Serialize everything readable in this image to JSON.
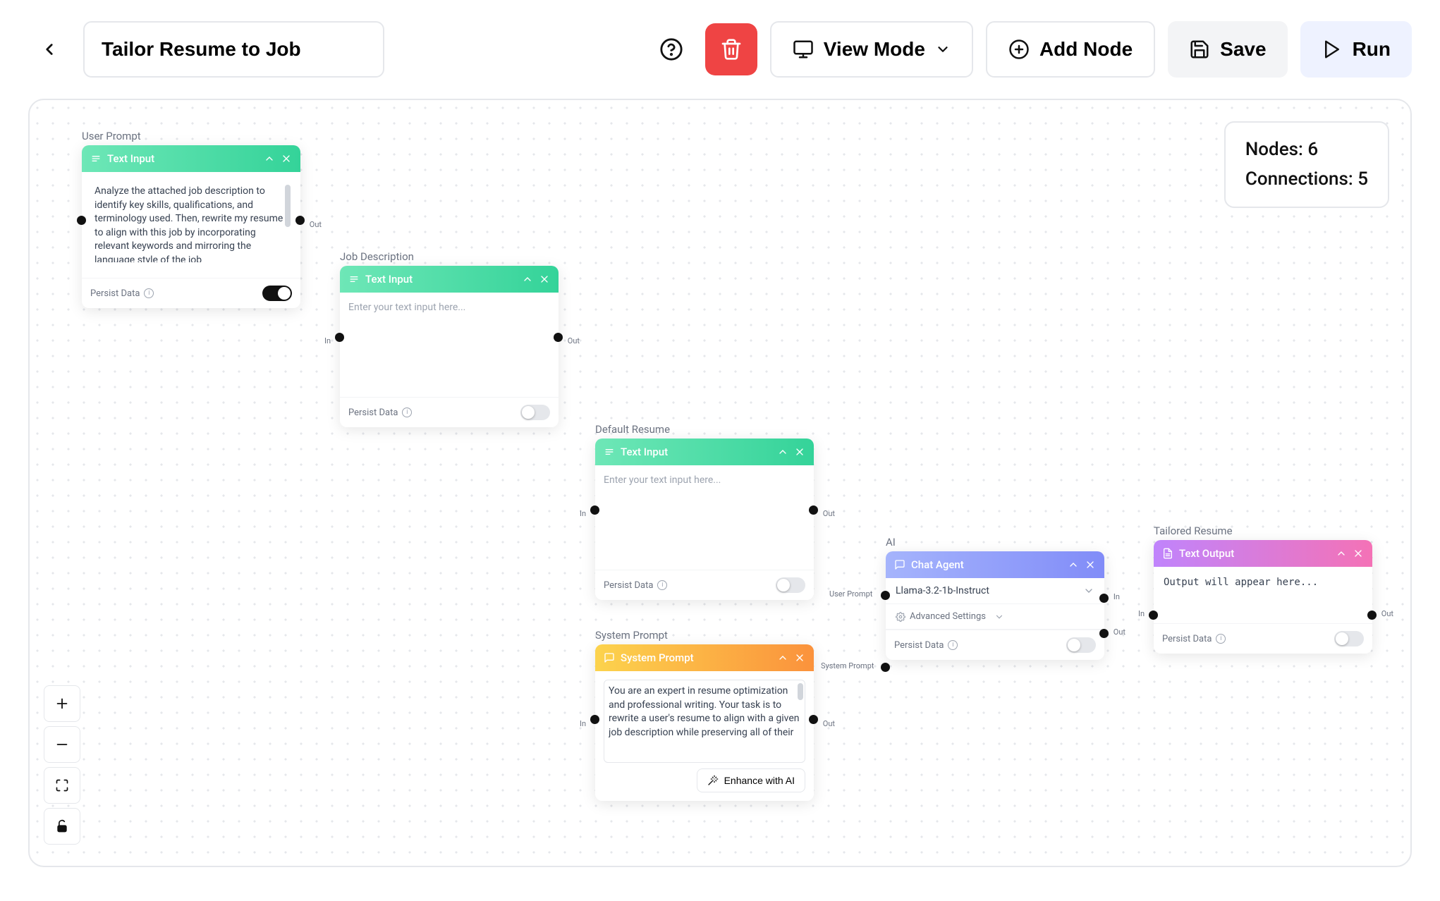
{
  "header": {
    "title": "Tailor Resume to Job",
    "view_mode": "View Mode",
    "add_node": "Add Node",
    "save": "Save",
    "run": "Run"
  },
  "stats": {
    "nodes_label": "Nodes: 6",
    "connections_label": "Connections: 5"
  },
  "nodes": {
    "user_prompt": {
      "label": "User Prompt",
      "type": "Text Input",
      "text": "Analyze the attached job description to identify key skills, qualifications, and terminology used. Then, rewrite my resume to align with this job by incorporating relevant keywords and mirroring the language style of the job",
      "persist_label": "Persist Data",
      "persist_on": true,
      "out_label": "Out"
    },
    "job_description": {
      "label": "Job Description",
      "type": "Text Input",
      "placeholder": "Enter your text input here...",
      "persist_label": "Persist Data",
      "persist_on": false,
      "in_label": "In",
      "out_label": "Out"
    },
    "default_resume": {
      "label": "Default Resume",
      "type": "Text Input",
      "placeholder": "Enter your text input here...",
      "persist_label": "Persist Data",
      "persist_on": false,
      "in_label": "In",
      "out_label": "Out"
    },
    "system_prompt": {
      "label": "System Prompt",
      "type": "System Prompt",
      "text": "You are an expert in resume optimization and professional writing. Your task is to rewrite a user's resume to align with a given job description while preserving all of their",
      "enhance": "Enhance with AI",
      "in_label": "In",
      "out_label": "Out"
    },
    "ai": {
      "label": "AI",
      "type": "Chat Agent",
      "model": "Llama-3.2-1b-Instruct",
      "advanced": "Advanced Settings",
      "persist_label": "Persist Data",
      "persist_on": false,
      "user_prompt_label": "User Prompt",
      "system_prompt_label": "System Prompt",
      "in_label": "In",
      "out_label": "Out"
    },
    "tailored_resume": {
      "label": "Tailored Resume",
      "type": "Text Output",
      "output_text": "Output will appear here...",
      "persist_label": "Persist Data",
      "persist_on": false,
      "in_label": "In",
      "out_label": "Out"
    }
  }
}
